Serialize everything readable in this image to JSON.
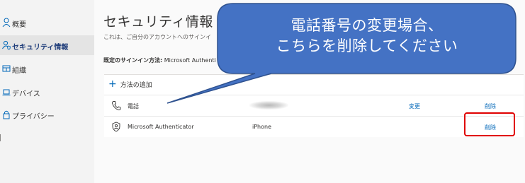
{
  "sidebar": {
    "items": [
      {
        "label": "概要",
        "icon": "person-icon",
        "active": false
      },
      {
        "label": "セキュリティ情報",
        "icon": "security-person-icon",
        "active": true
      },
      {
        "label": "組織",
        "icon": "organization-icon",
        "active": false
      },
      {
        "label": "デバイス",
        "icon": "laptop-icon",
        "active": false
      },
      {
        "label": "プライバシー",
        "icon": "lock-icon",
        "active": false
      }
    ]
  },
  "main": {
    "title": "セキュリティ情報",
    "description": "これは、ご自分のアカウントへのサインイ",
    "default_method_label": "既定のサインイン方法:",
    "default_method_value": " Microsoft Authenti",
    "add_method": "方法の追加",
    "methods": [
      {
        "icon": "phone-icon",
        "name": "電話",
        "detail": "",
        "change": "変更",
        "delete": "削除"
      },
      {
        "icon": "authenticator-icon",
        "name": "Microsoft Authenticator",
        "detail": "iPhone",
        "change": "",
        "delete": "削除"
      }
    ]
  },
  "callout": {
    "line1": "電話番号の変更場合、",
    "line2": "こちらを削除してください",
    "fill_color": "#4472c4",
    "border_color": "#2f528f"
  },
  "highlight_color": "#e00000",
  "accent_color": "#0067b8"
}
